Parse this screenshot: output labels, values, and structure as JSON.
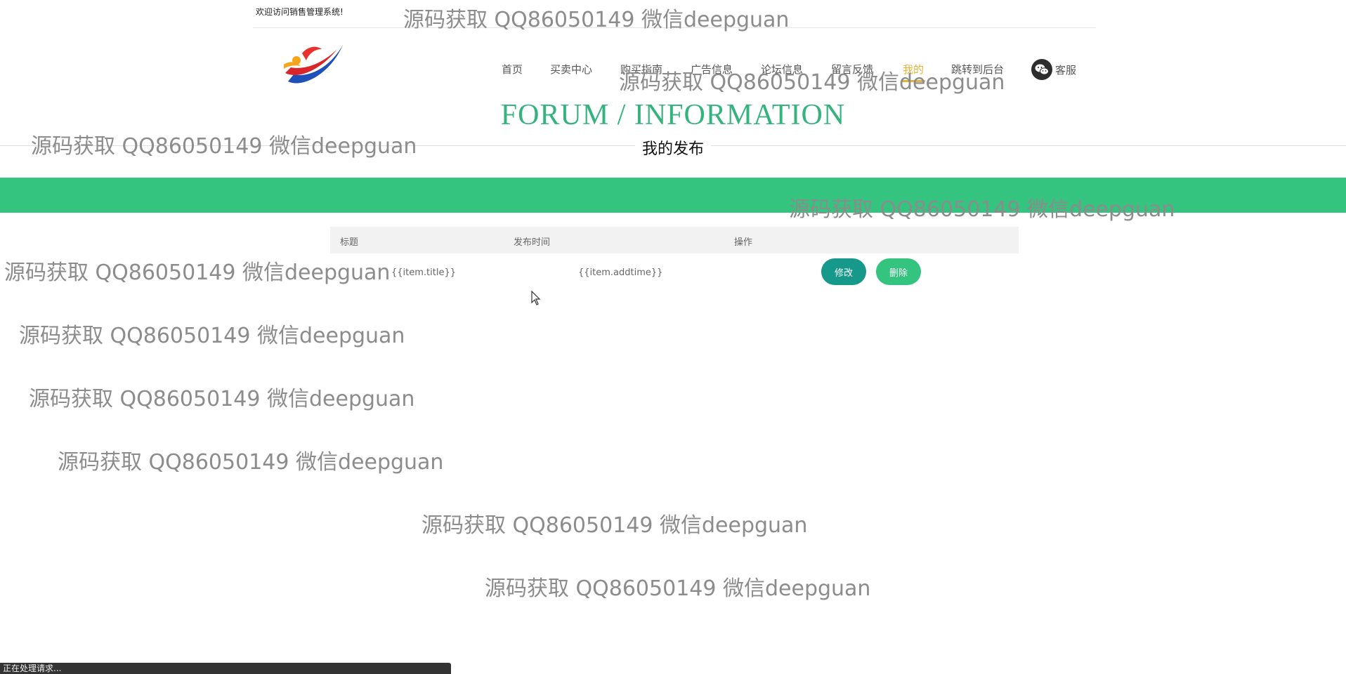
{
  "header": {
    "welcome": "欢迎访问销售管理系统!",
    "nav": [
      {
        "label": "首页"
      },
      {
        "label": "买卖中心"
      },
      {
        "label": "购买指南"
      },
      {
        "label": "广告信息"
      },
      {
        "label": "论坛信息"
      },
      {
        "label": "留言反馈"
      },
      {
        "label": "我的",
        "active": true
      },
      {
        "label": "跳转到后台"
      }
    ],
    "service_label": "客服"
  },
  "section": {
    "title": "FORUM / INFORMATION",
    "subtitle": "我的发布"
  },
  "table": {
    "headers": [
      "标题",
      "发布时间",
      "操作"
    ],
    "rows": [
      {
        "title": "{{item.title}}",
        "addtime": "{{item.addtime}}",
        "edit_label": "修改",
        "delete_label": "删除"
      }
    ]
  },
  "watermark_text": "源码获取 QQ86050149 微信deepguan",
  "status_text": "正在处理请求...",
  "colors": {
    "accent_green": "#35c47f",
    "title_green": "#35b37e",
    "edit_button": "#16998a",
    "active_nav": "#e4b33a"
  }
}
